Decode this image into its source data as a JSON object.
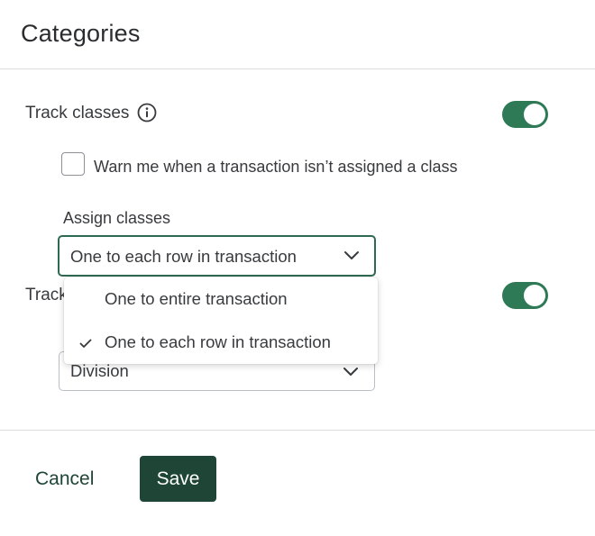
{
  "dialog": {
    "title": "Categories"
  },
  "track_classes": {
    "label": "Track classes",
    "info_icon": "info-circle-icon",
    "enabled": true,
    "warn_checkbox": {
      "label": "Warn me when a transaction isn’t assigned a class",
      "checked": false
    },
    "assign_classes": {
      "label": "Assign classes",
      "selected": "One to each row in transaction",
      "options": [
        {
          "label": "One to entire transaction",
          "selected": false
        },
        {
          "label": "One to each row in transaction",
          "selected": true
        }
      ]
    }
  },
  "track_locations": {
    "label_visible": "Track",
    "enabled": true,
    "select_value": "Division"
  },
  "footer": {
    "cancel_label": "Cancel",
    "save_label": "Save"
  },
  "colors": {
    "toggle_on": "#2e7a57",
    "primary_button": "#1e4536",
    "active_border": "#2e6a51",
    "divider": "#dcdde0"
  }
}
